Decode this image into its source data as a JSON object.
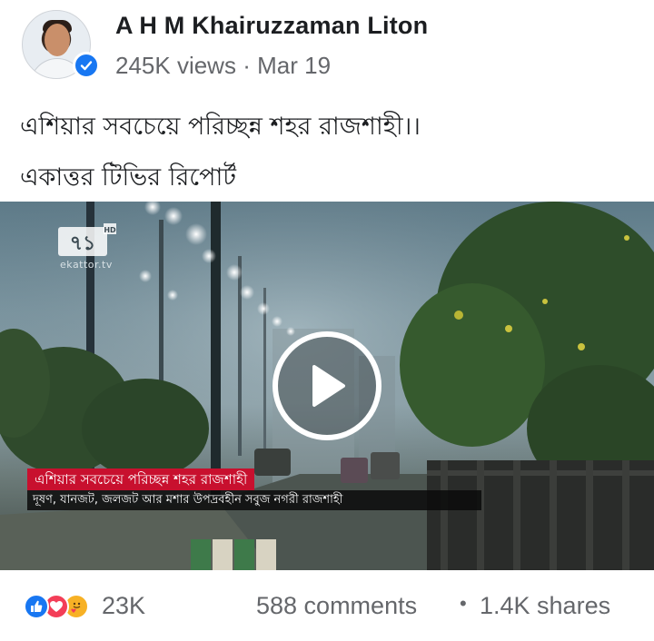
{
  "post": {
    "author": "A H M Khairuzzaman Liton",
    "views": "245K views",
    "separator": "·",
    "date": "Mar 19",
    "caption_line1": "এশিয়ার সবচেয়ে পরিচ্ছন্ন শহর রাজশাহী।।",
    "caption_line2": "একাত্তর টিভির রিপোর্ট"
  },
  "video": {
    "channel_logo_text": "৭১",
    "channel_logo_hd": "HD",
    "channel_site": "ekattor.tv",
    "headline": "এশিয়ার সবচেয়ে পরিচ্ছন্ন শহর রাজশাহী",
    "subheadline": "দূষণ, যানজট, জলজট আর মশার উপদ্রবহীন সবুজ নগরী রাজশাহী"
  },
  "footer": {
    "reaction_count": "23K",
    "comments": "588 comments",
    "separator": "•",
    "shares": "1.4K shares"
  },
  "icons": {
    "like": "like-reaction-icon",
    "love": "love-reaction-icon",
    "care": "care-reaction-icon",
    "verified": "verified-badge-icon",
    "play": "play-icon"
  },
  "colors": {
    "facebook_blue": "#1877f2",
    "love_red": "#f33e58",
    "care_yellow": "#f7b125",
    "channel_red": "#c8102e",
    "meta_gray": "#65676b"
  }
}
